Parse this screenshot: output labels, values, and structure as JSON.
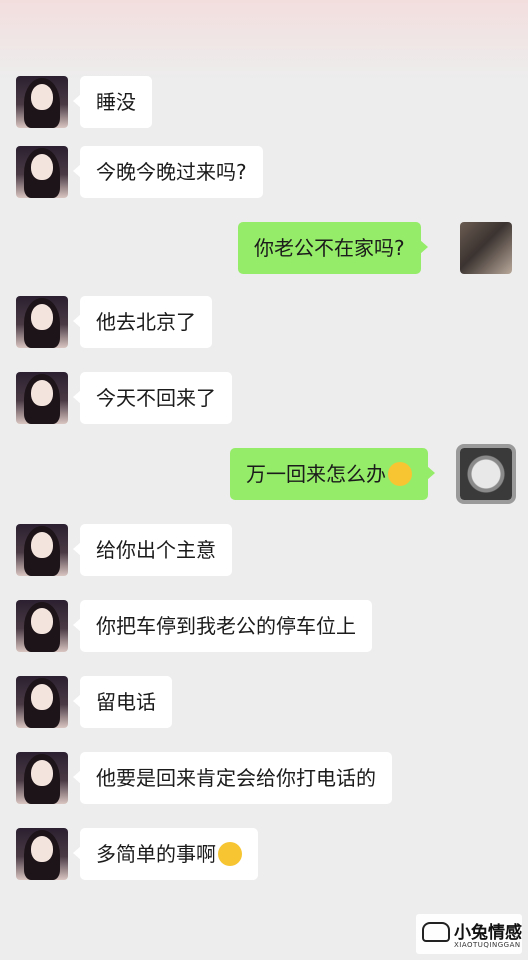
{
  "messages": [
    {
      "side": "in",
      "avatar": "girl-avatar",
      "text": "睡没"
    },
    {
      "side": "in",
      "avatar": "girl-avatar",
      "text": "今晚今晚过来吗?"
    },
    {
      "side": "out",
      "avatar": "man-avatar",
      "text": "你老公不在家吗?"
    },
    {
      "side": "in",
      "avatar": "girl-avatar",
      "text": "他去北京了"
    },
    {
      "side": "in",
      "avatar": "girl-avatar",
      "text": "今天不回来了"
    },
    {
      "side": "out",
      "avatar": "watch-avatar",
      "text": "万一回来怎么办",
      "emoji": "scream-emoji"
    },
    {
      "side": "in",
      "avatar": "girl-avatar",
      "text": "给你出个主意"
    },
    {
      "side": "in",
      "avatar": "girl-avatar",
      "text": "你把车停到我老公的停车位上"
    },
    {
      "side": "in",
      "avatar": "girl-avatar",
      "text": "留电话"
    },
    {
      "side": "in",
      "avatar": "girl-avatar",
      "text": "他要是回来肯定会给你打电话的"
    },
    {
      "side": "in",
      "avatar": "girl-avatar",
      "text": "多简单的事啊",
      "emoji": "kiss-emoji"
    }
  ],
  "watermark": {
    "title": "小兔情感",
    "subtitle": "XIAOTUQINGGAN",
    "logo": "rabbit-glasses-logo"
  },
  "colors": {
    "background": "#ededed",
    "incoming_bubble": "#ffffff",
    "outgoing_bubble": "#95ec69"
  }
}
